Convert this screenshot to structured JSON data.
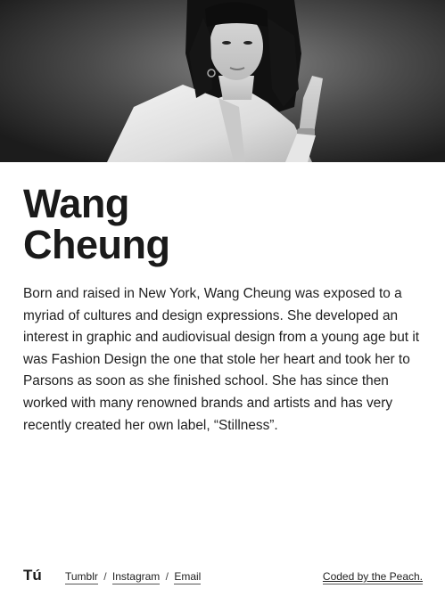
{
  "hero": {
    "image_alt": "Portrait of Wang Cheung"
  },
  "profile": {
    "name_line1": "Wang",
    "name_line2": "Cheung",
    "bio": "Born and raised in New York, Wang Cheung was exposed to a myriad of cultures and design expressions. She developed an interest in graphic and audiovisual design from a young age but it was Fashion Design the one that stole her heart and took her to Parsons as soon as she finished school. She has since then worked with many renowned brands and artists and has very recently created her own label, “Stillness”."
  },
  "footer": {
    "logo": "Tú",
    "links": [
      {
        "label": "Tumblr"
      },
      {
        "label": "Instagram"
      },
      {
        "label": "Email"
      }
    ],
    "separator": "/",
    "credit": "Coded by the Peach."
  }
}
